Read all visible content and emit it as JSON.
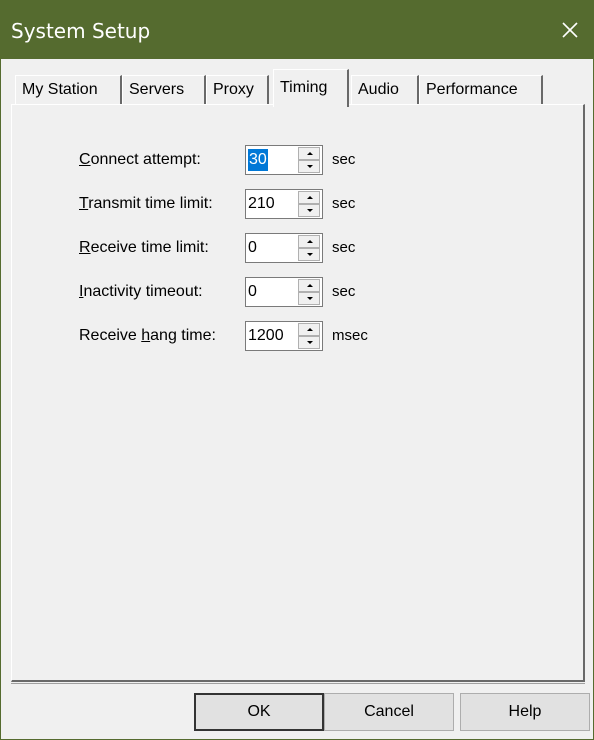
{
  "window": {
    "title": "System Setup"
  },
  "tabs": [
    {
      "label": "My Station",
      "active": false
    },
    {
      "label": "Servers",
      "active": false
    },
    {
      "label": "Proxy",
      "active": false
    },
    {
      "label": "Timing",
      "active": true
    },
    {
      "label": "Audio",
      "active": false
    },
    {
      "label": "Performance",
      "active": false
    }
  ],
  "timing": {
    "rows": [
      {
        "label_pre": "",
        "label_u": "C",
        "label_post": "onnect attempt:",
        "value": "30",
        "unit": "sec"
      },
      {
        "label_pre": "",
        "label_u": "T",
        "label_post": "ransmit time limit:",
        "value": "210",
        "unit": "sec"
      },
      {
        "label_pre": "",
        "label_u": "R",
        "label_post": "eceive time limit:",
        "value": "0",
        "unit": "sec"
      },
      {
        "label_pre": "",
        "label_u": "I",
        "label_post": "nactivity timeout:",
        "value": "0",
        "unit": "sec"
      },
      {
        "label_pre": "Receive ",
        "label_u": "h",
        "label_post": "ang time:",
        "value": "1200",
        "unit": "msec"
      }
    ]
  },
  "buttons": {
    "ok": "OK",
    "cancel": "Cancel",
    "help": "Help"
  },
  "icons": {
    "close": "close-icon"
  },
  "colors": {
    "titlebar": "#556b2f",
    "selection": "#0078d7"
  }
}
